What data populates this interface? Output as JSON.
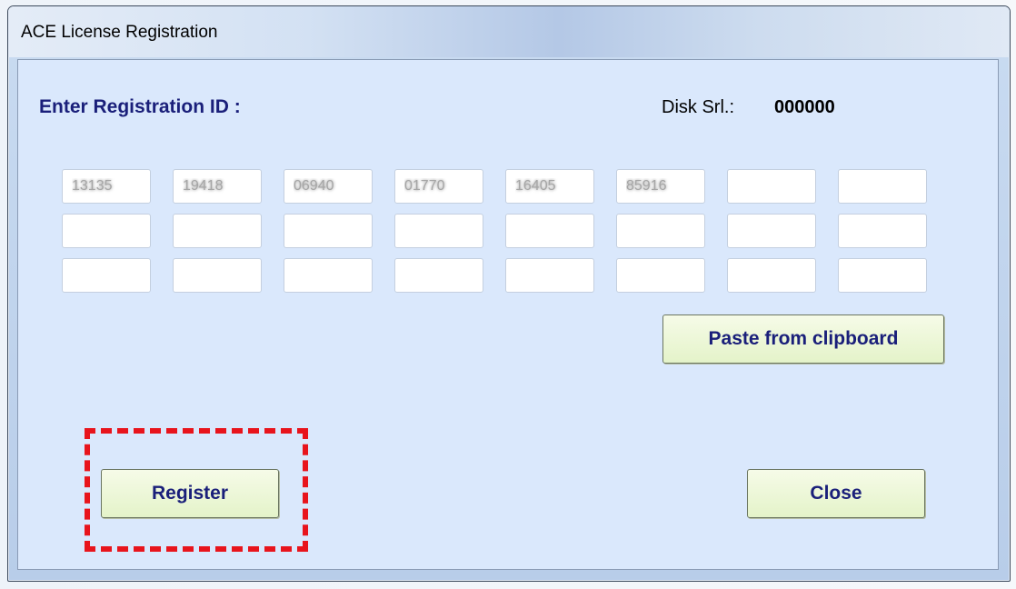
{
  "window": {
    "title": "ACE License Registration"
  },
  "form": {
    "heading": "Enter Registration ID :",
    "disk_label": "Disk Srl.:",
    "disk_value": "000000",
    "fields": [
      [
        "13135",
        "19418",
        "06940",
        "01770",
        "16405",
        "85916",
        "",
        ""
      ],
      [
        "",
        "",
        "",
        "",
        "",
        "",
        "",
        ""
      ],
      [
        "",
        "",
        "",
        "",
        "",
        "",
        "",
        ""
      ]
    ]
  },
  "buttons": {
    "paste_label": "Paste from clipboard",
    "register_label": "Register",
    "close_label": "Close"
  },
  "colors": {
    "client_bg": "#dae8fc",
    "heading_text": "#1a1f7a",
    "button_bg": "#e4f3c9",
    "highlight": "#e8141c"
  }
}
